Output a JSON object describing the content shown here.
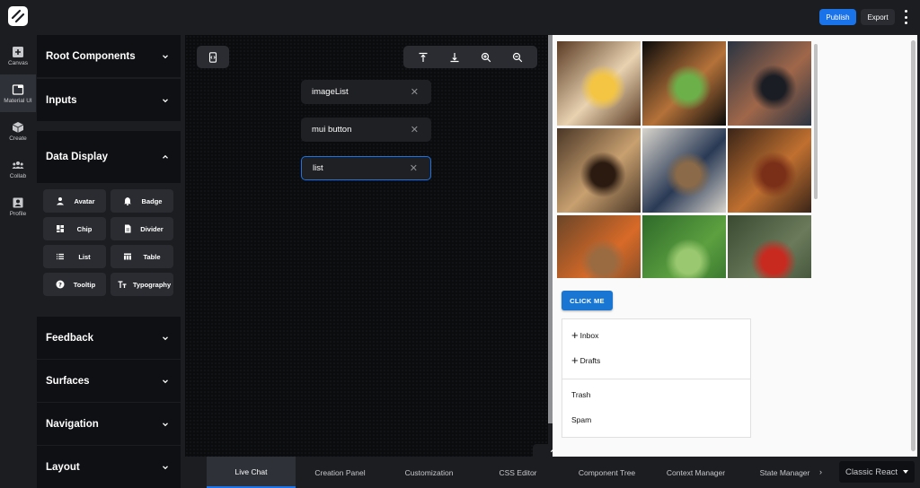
{
  "header": {
    "publish_label": "Publish",
    "export_label": "Export",
    "more_icon": "more-vertical-icon"
  },
  "rail": {
    "items": [
      {
        "label": "Canvas",
        "icon": "plus-square-icon",
        "active": false
      },
      {
        "label": "Material UI",
        "icon": "window-icon",
        "active": true
      },
      {
        "label": "Create",
        "icon": "cube-icon",
        "active": false
      },
      {
        "label": "Collab",
        "icon": "group-icon",
        "active": false
      },
      {
        "label": "Profile",
        "icon": "profile-icon",
        "active": false
      }
    ]
  },
  "panel": {
    "sections": [
      {
        "title": "Root Components",
        "expanded": false
      },
      {
        "title": "Inputs",
        "expanded": false
      },
      {
        "title": "Data Display",
        "expanded": true
      },
      {
        "title": "Feedback",
        "expanded": false
      },
      {
        "title": "Surfaces",
        "expanded": false
      },
      {
        "title": "Navigation",
        "expanded": false
      },
      {
        "title": "Layout",
        "expanded": false
      }
    ],
    "data_display_items": [
      {
        "label": "Avatar",
        "icon": "person-icon"
      },
      {
        "label": "Badge",
        "icon": "bell-icon"
      },
      {
        "label": "Chip",
        "icon": "dashboard-icon"
      },
      {
        "label": "Divider",
        "icon": "document-icon"
      },
      {
        "label": "List",
        "icon": "list-icon"
      },
      {
        "label": "Table",
        "icon": "table-icon"
      },
      {
        "label": "Tooltip",
        "icon": "help-icon"
      },
      {
        "label": "Typography",
        "icon": "text-fields-icon"
      }
    ]
  },
  "canvas": {
    "components": [
      {
        "label": "imageList",
        "selected": false
      },
      {
        "label": "mui button",
        "selected": false
      },
      {
        "label": "list",
        "selected": true
      }
    ],
    "toolbar": [
      "align-top-icon",
      "align-bottom-icon",
      "zoom-in-icon",
      "zoom-out-icon"
    ],
    "code_icon": "code-phone-icon"
  },
  "preview": {
    "images": [
      {
        "subject": "breakfast",
        "colors": [
          "#5a3a24",
          "#e8d2b0",
          "#f4c542"
        ]
      },
      {
        "subject": "burger",
        "colors": [
          "#0a0a0a",
          "#b5723a",
          "#6cb04a"
        ]
      },
      {
        "subject": "camera",
        "colors": [
          "#2a3442",
          "#a0674a",
          "#1a1d24"
        ]
      },
      {
        "subject": "coffee",
        "colors": [
          "#4a3626",
          "#c8a070",
          "#2a1a10"
        ]
      },
      {
        "subject": "hats",
        "colors": [
          "#d8d4cc",
          "#2a3a55",
          "#8a6a48"
        ]
      },
      {
        "subject": "honey",
        "colors": [
          "#3a2418",
          "#c07030",
          "#7a3018"
        ]
      },
      {
        "subject": "basketball",
        "colors": [
          "#6a4528",
          "#d86a28",
          "#9a6a40"
        ]
      },
      {
        "subject": "fern",
        "colors": [
          "#2e6a2a",
          "#5ca040",
          "#9ac870"
        ]
      },
      {
        "subject": "mushroom",
        "colors": [
          "#3a4a32",
          "#6a7a5a",
          "#c82a20"
        ]
      }
    ],
    "button_label": "CLICK ME",
    "list_items": [
      {
        "label": "Inbox",
        "icon": "plus-icon"
      },
      {
        "label": "Drafts",
        "icon": "plus-icon"
      },
      {
        "label": "Trash",
        "icon": ""
      },
      {
        "label": "Spam",
        "icon": ""
      }
    ]
  },
  "bottom": {
    "tabs": [
      {
        "label": "Live Chat",
        "active": true
      },
      {
        "label": "Creation Panel",
        "active": false
      },
      {
        "label": "Customization",
        "active": false
      },
      {
        "label": "CSS Editor",
        "active": false
      },
      {
        "label": "Component Tree",
        "active": false
      },
      {
        "label": "Context Manager",
        "active": false
      },
      {
        "label": "State Manager",
        "active": false
      }
    ],
    "next_icon": "chevron-right-icon",
    "framework_select": "Classic React"
  },
  "colors": {
    "accent": "#1a73e8",
    "mui_primary": "#1976d2",
    "background": "#1c1d21",
    "panel_dark": "#0f1013"
  }
}
